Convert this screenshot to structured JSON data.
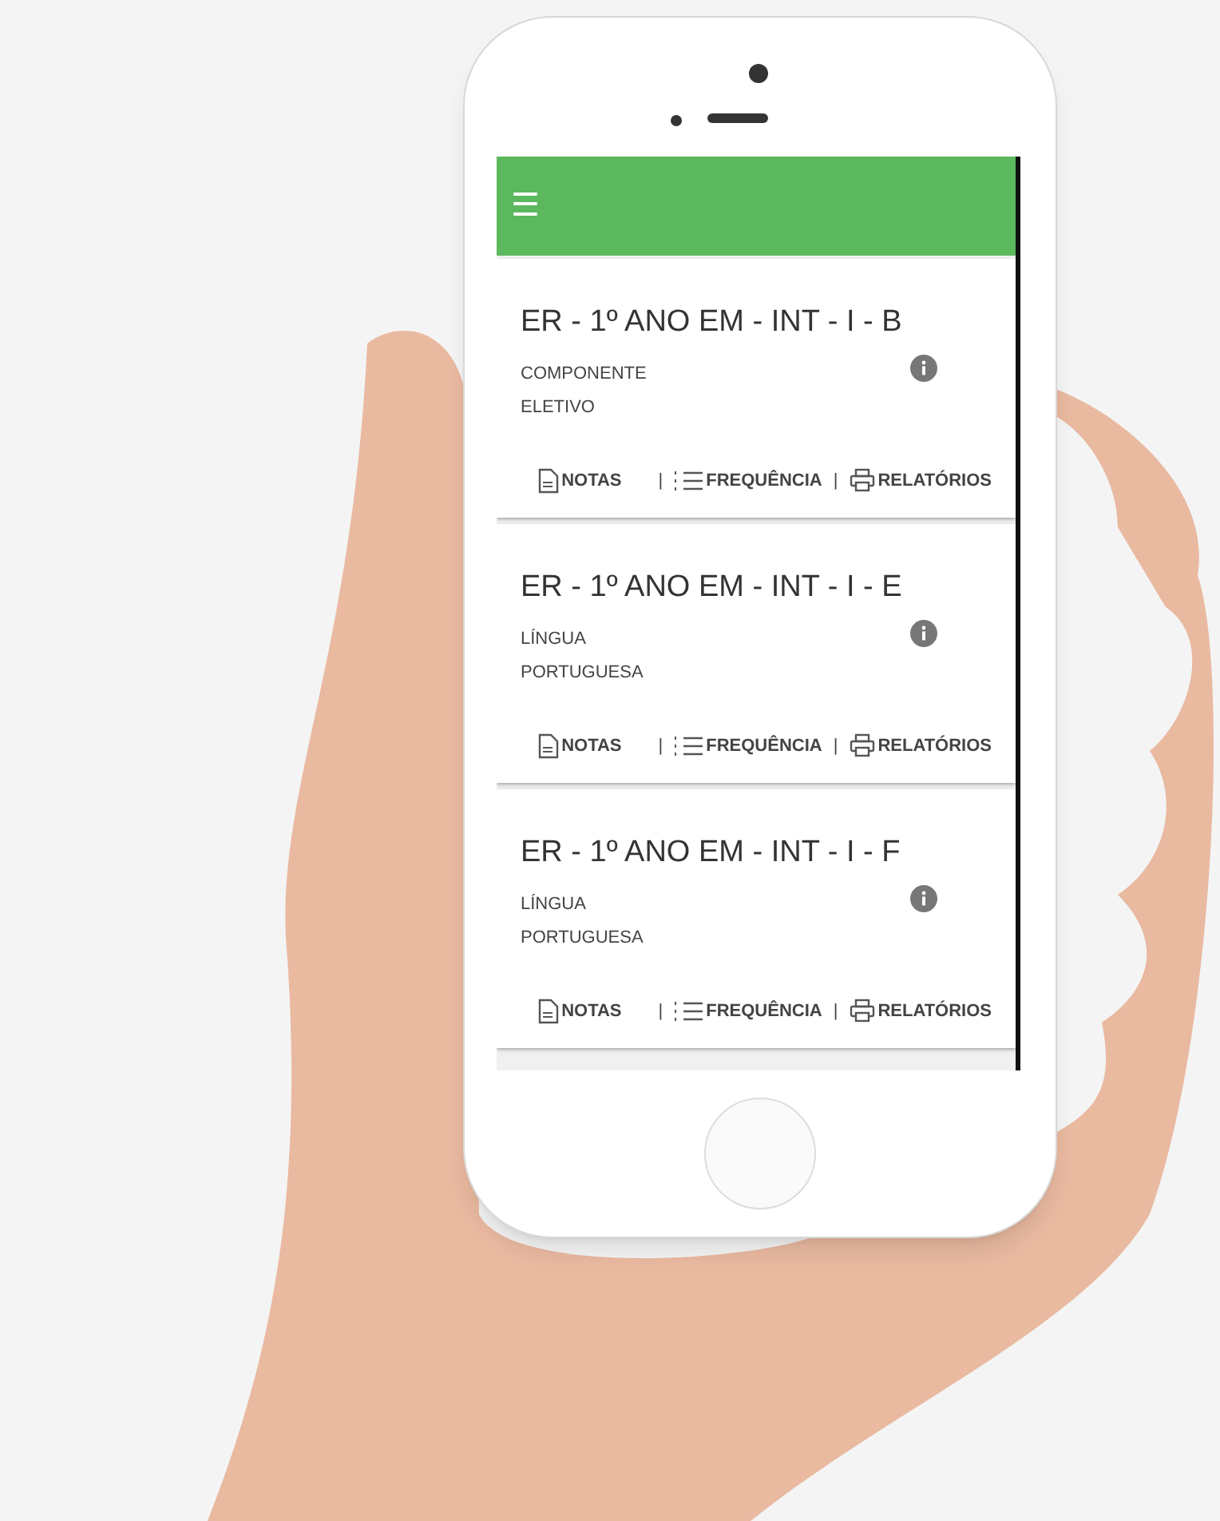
{
  "app_bar": {
    "menu_icon": "☰"
  },
  "cards": [
    {
      "title": "ER - 1º ANO EM - INT - I - B",
      "subject": "COMPONENTE ELETIVO",
      "actions": [
        {
          "kind": "notes",
          "label": "NOTAS"
        },
        {
          "kind": "separator",
          "label": "|"
        },
        {
          "kind": "attendance",
          "label": "FREQUÊNCIA"
        },
        {
          "kind": "separator",
          "label": "|"
        },
        {
          "kind": "reports",
          "label": "RELATÓRIOS"
        }
      ]
    },
    {
      "title": "ER - 1º ANO EM - INT - I - E",
      "subject": "LÍNGUA PORTUGUESA",
      "actions": [
        {
          "kind": "notes",
          "label": "NOTAS"
        },
        {
          "kind": "separator",
          "label": "|"
        },
        {
          "kind": "attendance",
          "label": "FREQUÊNCIA"
        },
        {
          "kind": "separator",
          "label": "|"
        },
        {
          "kind": "reports",
          "label": "RELATÓRIOS"
        }
      ]
    },
    {
      "title": "ER - 1º ANO EM - INT - I - F",
      "subject": "LÍNGUA PORTUGUESA",
      "actions": [
        {
          "kind": "notes",
          "label": "NOTAS"
        },
        {
          "kind": "separator",
          "label": "|"
        },
        {
          "kind": "attendance",
          "label": "FREQUÊNCIA"
        },
        {
          "kind": "separator",
          "label": "|"
        },
        {
          "kind": "reports",
          "label": "RELATÓRIOS"
        }
      ]
    }
  ]
}
